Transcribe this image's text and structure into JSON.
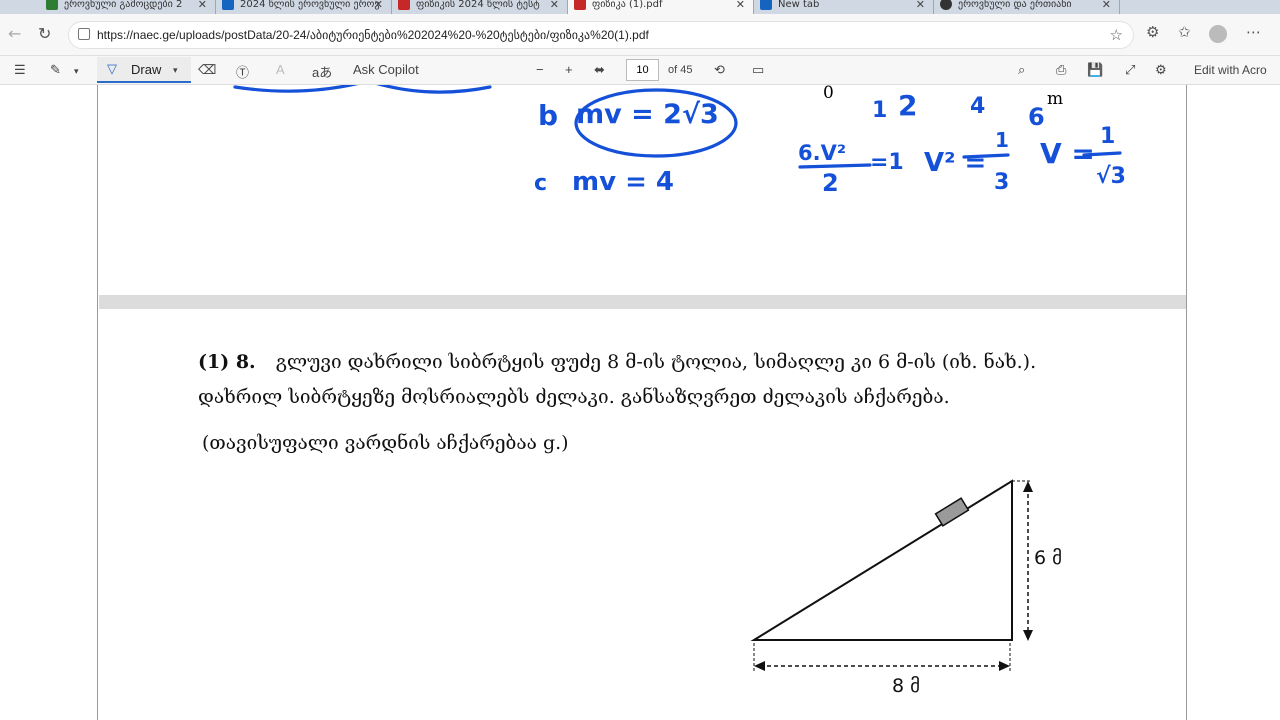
{
  "browser": {
    "tabs": [
      {
        "title": "ეროვნული გამოცდები 2",
        "fav": "#2e7d32"
      },
      {
        "title": "2024 წლის ეროვნული ეროვ",
        "fav": "#1565c0"
      },
      {
        "title": "ფიზიკის 2024 წლის ტესტ",
        "fav": "#c62828"
      },
      {
        "title": "ფიზიკა (1).pdf",
        "fav": "#c62828"
      },
      {
        "title": "New tab",
        "fav": "#1565c0"
      },
      {
        "title": "ეროვნული და ერთიანი",
        "fav": "#333333"
      }
    ],
    "url": "https://naec.ge/uploads/postData/20-24/აბიტურიენტები%202024%20-%20ტესტები/ფიზიკა%20(1).pdf"
  },
  "pdf_toolbar": {
    "draw_label": "Draw",
    "read_aloud_label": "aあ",
    "copilot_label": "Ask Copilot",
    "minus": "−",
    "plus": "+",
    "page_current": "10",
    "page_total": "of 45",
    "edit_label": "Edit with Acro"
  },
  "handwriting": {
    "b_label": "b",
    "b_eq": "mv = 2√3",
    "c_label": "c",
    "c_eq": "mv = 4",
    "eq1_num": "6.V²",
    "eq1_den": "2",
    "eq1_rhs": "=1",
    "eq2": "V² =",
    "eq2_num": "1",
    "eq2_den": "3",
    "eq3": "V =",
    "eq3_num": "1",
    "eq3_den": "√3",
    "nums": [
      "1",
      "2",
      "4",
      "6"
    ]
  },
  "prev_page": {
    "zero": "0",
    "unit": "m"
  },
  "question": {
    "number": "(1) 8.",
    "line1": "გლუვი დახრილი სიბრტყის ფუძე 8 მ-ის ტოლია, სიმაღლე კი 6 მ-ის (იხ. ნახ.).",
    "line2": "დახრილ სიბრტყეზე მოსრიალებს ძელაკი.  განსაზღვრეთ ძელაკის აჩქარება.",
    "line3": "(თავისუფალი ვარდნის აჩქარებაა g.)"
  },
  "figure": {
    "height_label": "6 მ",
    "base_label": "8 მ"
  }
}
